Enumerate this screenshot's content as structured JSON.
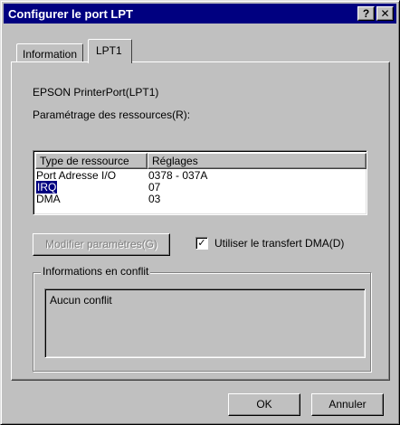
{
  "window": {
    "title": "Configurer le port LPT",
    "help_button": "?",
    "close_button": "✕"
  },
  "tabs": [
    {
      "label": "Information"
    },
    {
      "label": "LPT1"
    }
  ],
  "device_name": "EPSON PrinterPort(LPT1)",
  "resources_label": "Paramétrage des ressources(R):",
  "resource_table": {
    "columns": [
      "Type de ressource",
      "Réglages"
    ],
    "rows": [
      {
        "type": "Port Adresse I/O",
        "setting": "0378 - 037A"
      },
      {
        "type": "IRQ",
        "setting": "07",
        "selected": true
      },
      {
        "type": "DMA",
        "setting": "03"
      }
    ]
  },
  "modify_button": "Modifier paramètres(G)",
  "dma_checkbox": {
    "label": "Utiliser le transfert DMA(D)",
    "checked": true,
    "mark": "✓"
  },
  "conflict_group": {
    "label": "Informations en conflit",
    "text": "Aucun conflit"
  },
  "ok_button": "OK",
  "cancel_button": "Annuler",
  "colors": {
    "titlebar": "#000080",
    "face": "#c0c0c0",
    "selection": "#000080"
  }
}
